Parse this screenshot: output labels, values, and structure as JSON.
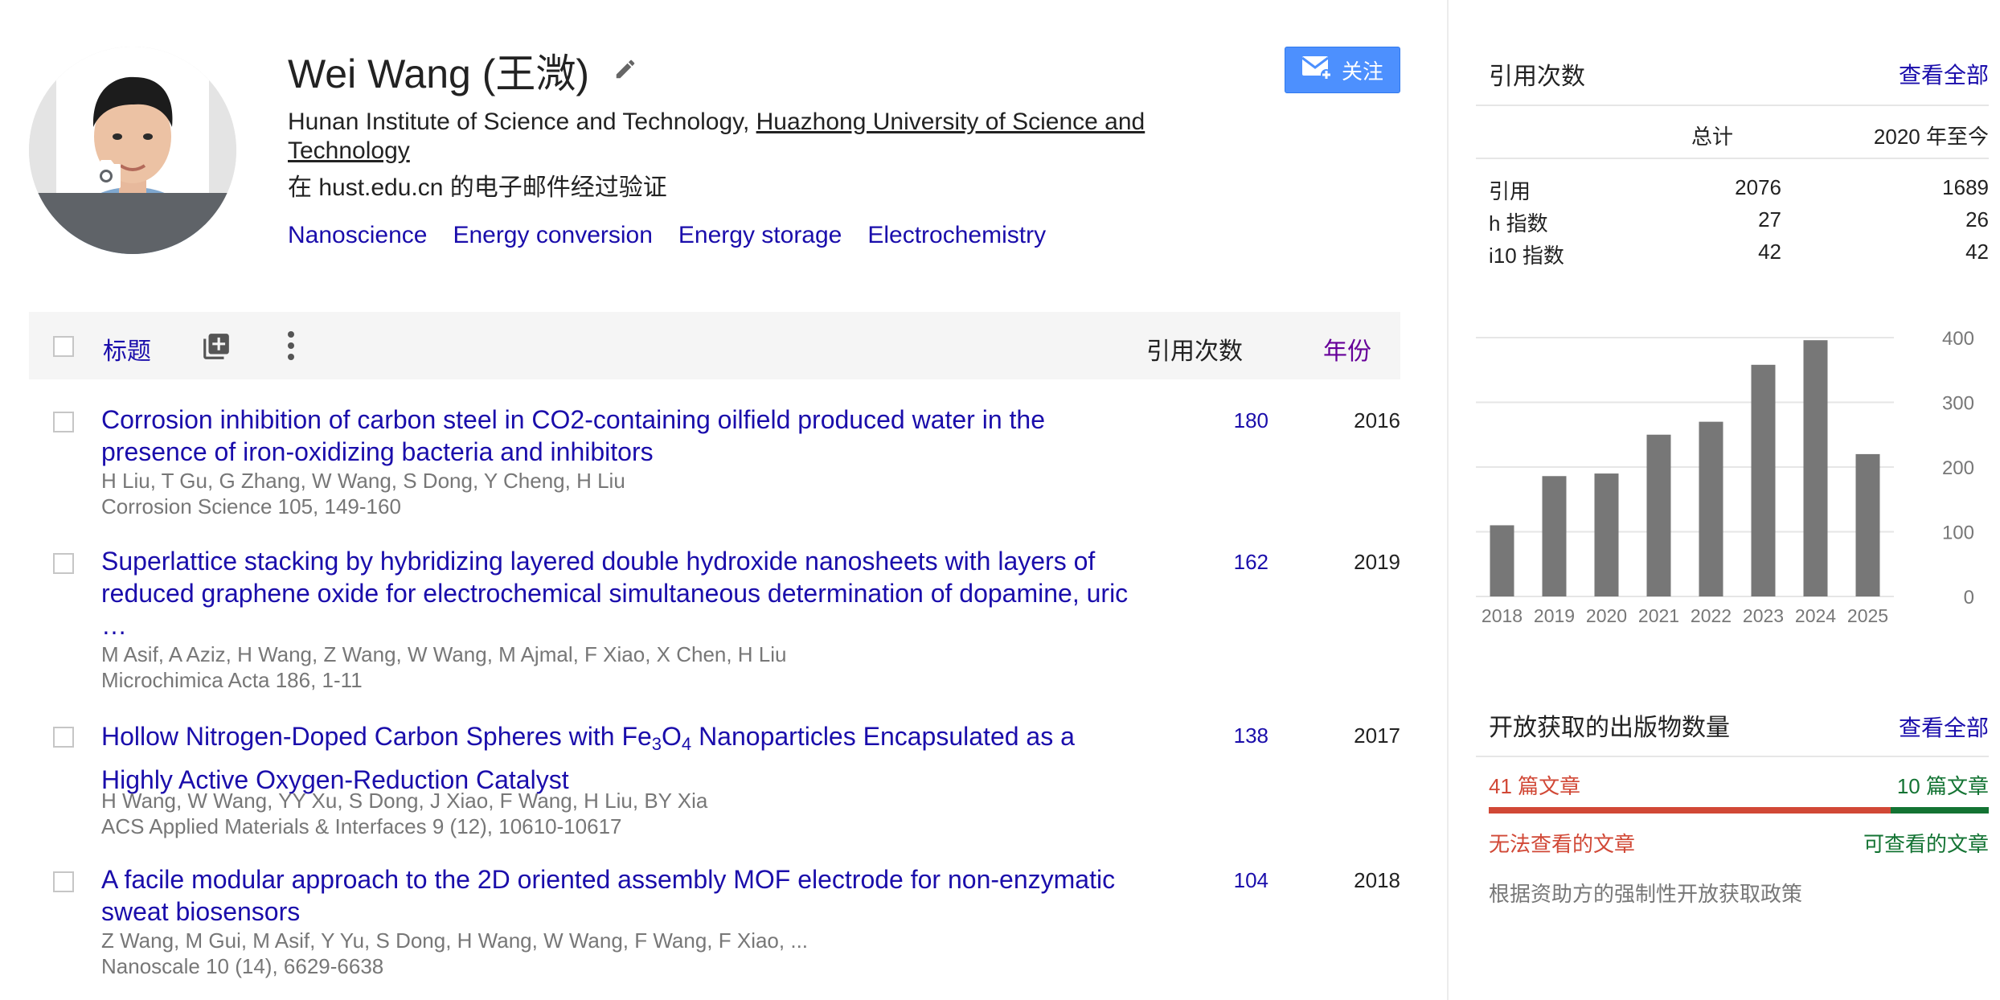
{
  "profile": {
    "name": "Wei Wang (王溦)",
    "affiliation_plain": "Hunan Institute of Science and Technology, ",
    "affiliation_link": "Huazhong University of Science and Technology",
    "verified": "在 hust.edu.cn 的电子邮件经过验证",
    "interests": [
      "Nanoscience",
      "Energy conversion",
      "Energy storage",
      "Electrochemistry"
    ],
    "follow_label": "关注",
    "icons": [
      "camera-icon",
      "pencil-icon",
      "mail-icon"
    ]
  },
  "table_header": {
    "title": "标题",
    "cites": "引用次数",
    "year": "年份",
    "icons": [
      "add-icon",
      "more-vert-icon"
    ]
  },
  "articles": [
    {
      "title": "Corrosion inhibition of carbon steel in CO2-containing oilfield produced water in the presence of iron-oxidizing bacteria and inhibitors",
      "authors": "H Liu, T Gu, G Zhang, W Wang, S Dong, Y Cheng, H Liu",
      "venue": "Corrosion Science 105, 149-160",
      "cites": "180",
      "year": "2016"
    },
    {
      "title": "Superlattice stacking by hybridizing layered double hydroxide nanosheets with layers of reduced graphene oxide for electrochemical simultaneous determination of dopamine, uric …",
      "authors": "M Asif, A Aziz, H Wang, Z Wang, W Wang, M Ajmal, F Xiao, X Chen, H Liu",
      "venue": "Microchimica Acta 186, 1-11",
      "cites": "162",
      "year": "2019"
    },
    {
      "title_part1": "Hollow Nitrogen-Doped Carbon Spheres with Fe",
      "title_sub1": "3",
      "title_part2": "O",
      "title_sub2": "4",
      "title_part3": " Nanoparticles Encapsulated as a Highly Active Oxygen-Reduction Catalyst",
      "authors": "H Wang, W Wang, YY Xu, S Dong, J Xiao, F Wang, H Liu, BY Xia",
      "venue": "ACS Applied Materials & Interfaces 9 (12), 10610-10617",
      "cites": "138",
      "year": "2017"
    },
    {
      "title": "A facile modular approach to the 2D oriented assembly MOF electrode for non-enzymatic sweat biosensors",
      "authors": "Z Wang, M Gui, M Asif, Y Yu, S Dong, H Wang, W Wang, F Wang, F Xiao, ...",
      "venue": "Nanoscale 10 (14), 6629-6638",
      "cites": "104",
      "year": "2018"
    }
  ],
  "citations": {
    "title": "引用次数",
    "view_all": "查看全部",
    "col_total": "总计",
    "col_since": "2020 年至今",
    "rows": [
      {
        "label": "引用",
        "total": "2076",
        "since": "1689"
      },
      {
        "label": "h 指数",
        "total": "27",
        "since": "26"
      },
      {
        "label": "i10 指数",
        "total": "42",
        "since": "42"
      }
    ]
  },
  "chart_data": {
    "type": "bar",
    "categories": [
      "2018",
      "2019",
      "2020",
      "2021",
      "2022",
      "2023",
      "2024",
      "2025"
    ],
    "values": [
      110,
      186,
      190,
      250,
      270,
      358,
      396,
      220
    ],
    "ylim": [
      0,
      400
    ],
    "yticks": [
      "0",
      "100",
      "200",
      "300",
      "400"
    ],
    "bar_color": "#777777",
    "grid": true
  },
  "open_access": {
    "title": "开放获取的出版物数量",
    "view_all": "查看全部",
    "unavailable_count": "41 篇文章",
    "available_count": "10 篇文章",
    "unavailable_fraction": 0.804,
    "unavailable_label": "无法查看的文章",
    "available_label": "可查看的文章",
    "note": "根据资助方的强制性开放获取政策",
    "colors": {
      "unavailable": "#d14836",
      "available": "#137333"
    }
  }
}
